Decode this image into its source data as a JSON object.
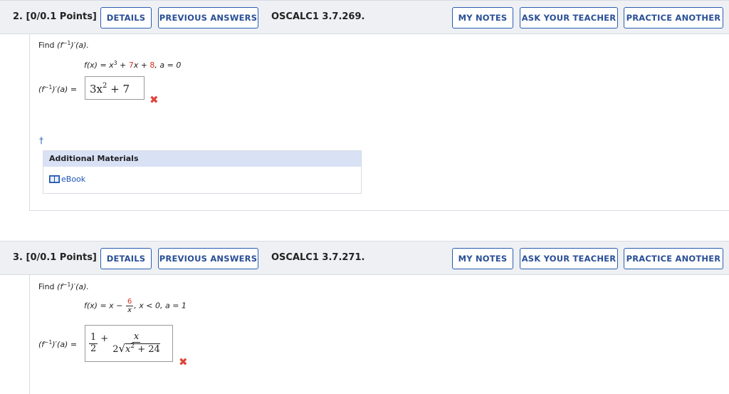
{
  "q2": {
    "number": "2.",
    "points": "[0/0.1 Points]",
    "details": "DETAILS",
    "previous": "PREVIOUS ANSWERS",
    "code": "OSCALC1 3.7.269.",
    "notes": "MY NOTES",
    "ask": "ASK YOUR TEACHER",
    "practice": "PRACTICE ANOTHER",
    "find_prefix": "Find ",
    "find_func": "(f",
    "find_exp": "−1",
    "find_suffix": ")′(a).",
    "fn_lhs": "f(x) = x",
    "fn_exp": "3",
    "fn_mid": " + ",
    "fn_c1": "7",
    "fn_x": "x + ",
    "fn_c2": "8",
    "fn_tail": ", a = 0",
    "ans_label_1": "(f",
    "ans_label_exp": "−1",
    "ans_label_2": ")′(a) =",
    "answer_base": "3x",
    "answer_exp": "2",
    "answer_tail": " + 7",
    "dagger": "†",
    "additional": "Additional Materials",
    "ebook": "eBook"
  },
  "q3": {
    "number": "3.",
    "points": "[0/0.1 Points]",
    "details": "DETAILS",
    "previous": "PREVIOUS ANSWERS",
    "code": "OSCALC1 3.7.271.",
    "notes": "MY NOTES",
    "ask": "ASK YOUR TEACHER",
    "practice": "PRACTICE ANOTHER",
    "find_prefix": "Find ",
    "find_func": "(f",
    "find_exp": "−1",
    "find_suffix": ")′(a).",
    "fn_lhs": "f(x) = x −",
    "fn_num": "6",
    "fn_den": "x",
    "fn_tail": ", x < 0, a = 1",
    "ans_label_1": "(f",
    "ans_label_exp": "−1",
    "ans_label_2": ")′(a) =",
    "frac1_num": "1",
    "frac1_den": "2",
    "plus": "+",
    "frac2_num": "x",
    "frac2_den_coef": "2",
    "frac2_den_rad": "x",
    "frac2_den_exp": "2",
    "frac2_den_tail": " + 24"
  },
  "icons": {
    "wrong": "x-mark-icon",
    "book": "book-icon"
  },
  "colors": {
    "accent": "#2a5db0",
    "wrong": "#e0443a",
    "highlight": "#d4321e",
    "bar": "#eef0f4"
  }
}
